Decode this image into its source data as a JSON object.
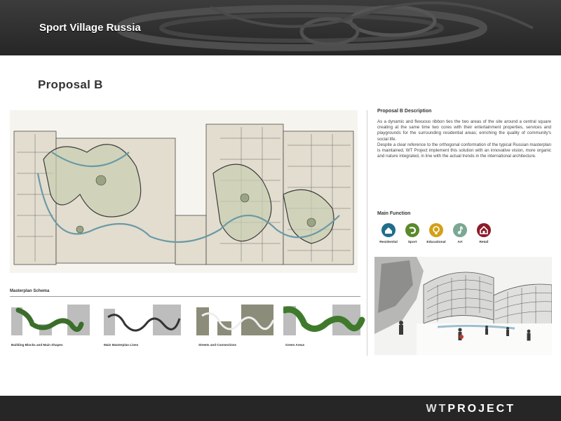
{
  "header": {
    "title": "Sport Village Russia"
  },
  "slide": {
    "title": "Proposal B"
  },
  "schema": {
    "heading": "Masterplan Schema",
    "items": [
      {
        "caption": "Building Blocks and Main Shapes"
      },
      {
        "caption": "Main Masterplan Lines"
      },
      {
        "caption": "Streets and Connections"
      },
      {
        "caption": "Green Areas"
      }
    ]
  },
  "description": {
    "heading": "Proposal B Description",
    "paragraphs": [
      "As a dynamic and flexuous ribbon ties the two areas of the site around a central square creating at the same time two cores with their entertainment properties, services and playgrounds for the surrounding residential areas; enriching the quality of community's social life.",
      "Despite a clear reference to the orthogonal conformation of the typical Russian masterplan is maintained, WT Project implement this solution with an innovative vision, more organic and nature integrated, in line with the actual trends in the international architecture."
    ]
  },
  "functions": {
    "heading": "Main Function",
    "items": [
      {
        "label": "Residential",
        "color": "#1f6e8c",
        "icon": "house-icon"
      },
      {
        "label": "Sport",
        "color": "#5a8a2a",
        "icon": "sport-swoosh-icon"
      },
      {
        "label": "Educational",
        "color": "#d4a017",
        "icon": "lightbulb-icon"
      },
      {
        "label": "Art",
        "color": "#7aa893",
        "icon": "music-note-icon"
      },
      {
        "label": "Retail",
        "color": "#8c1c2a",
        "icon": "shop-house-icon"
      }
    ]
  },
  "footer": {
    "brand_wt": "WT",
    "brand_project": "PROJECT"
  }
}
